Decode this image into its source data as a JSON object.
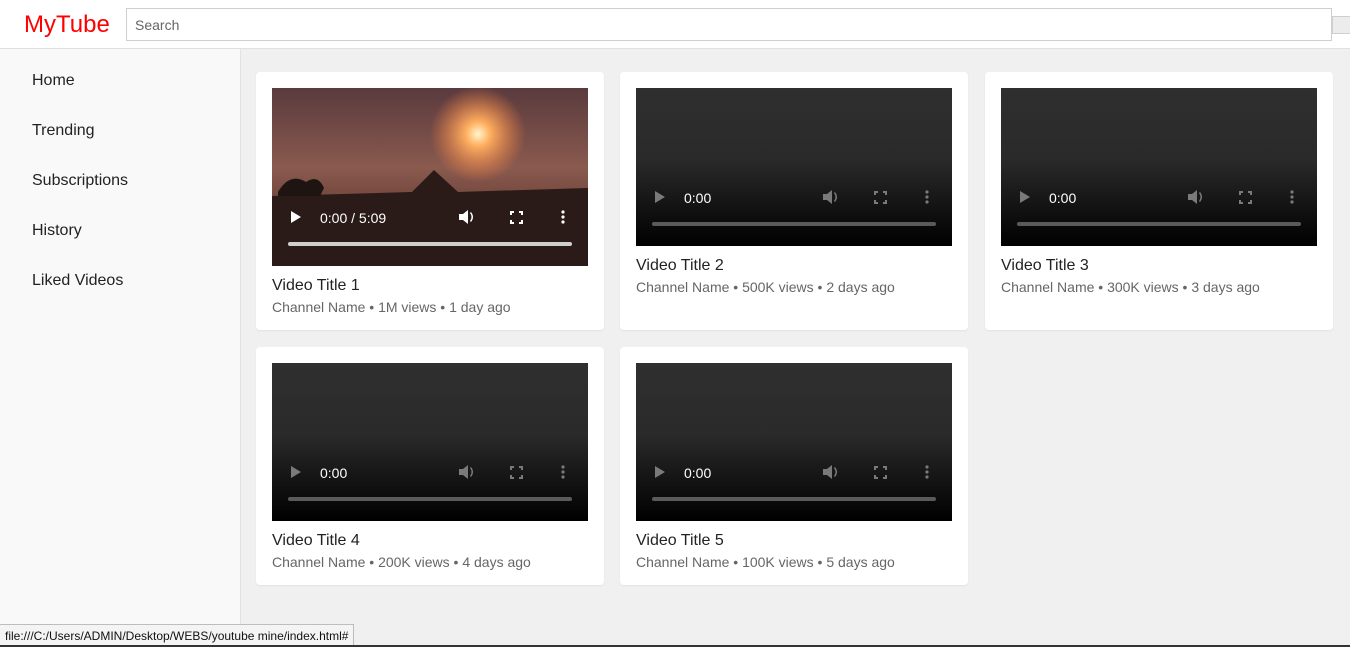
{
  "header": {
    "logo": "MyTube",
    "search_placeholder": "Search"
  },
  "sidebar": {
    "items": [
      {
        "label": "Home"
      },
      {
        "label": "Trending"
      },
      {
        "label": "Subscriptions"
      },
      {
        "label": "History"
      },
      {
        "label": "Liked Videos"
      }
    ]
  },
  "videos": [
    {
      "title": "Video Title 1",
      "meta": "Channel Name • 1M views • 1 day ago",
      "time": "0:00 / 5:09"
    },
    {
      "title": "Video Title 2",
      "meta": "Channel Name • 500K views • 2 days ago",
      "time": "0:00"
    },
    {
      "title": "Video Title 3",
      "meta": "Channel Name • 300K views • 3 days ago",
      "time": "0:00"
    },
    {
      "title": "Video Title 4",
      "meta": "Channel Name • 200K views • 4 days ago",
      "time": "0:00"
    },
    {
      "title": "Video Title 5",
      "meta": "Channel Name • 100K views • 5 days ago",
      "time": "0:00"
    }
  ],
  "statusbar": {
    "url": "file:///C:/Users/ADMIN/Desktop/WEBS/youtube mine/index.html#"
  },
  "colors": {
    "brand": "#ff0000",
    "page_bg": "#f0f0f0",
    "sidebar_bg": "#f9f9f9",
    "card_bg": "#ffffff"
  },
  "icons": [
    "play-icon",
    "volume-icon",
    "fullscreen-icon",
    "more-options-icon"
  ]
}
